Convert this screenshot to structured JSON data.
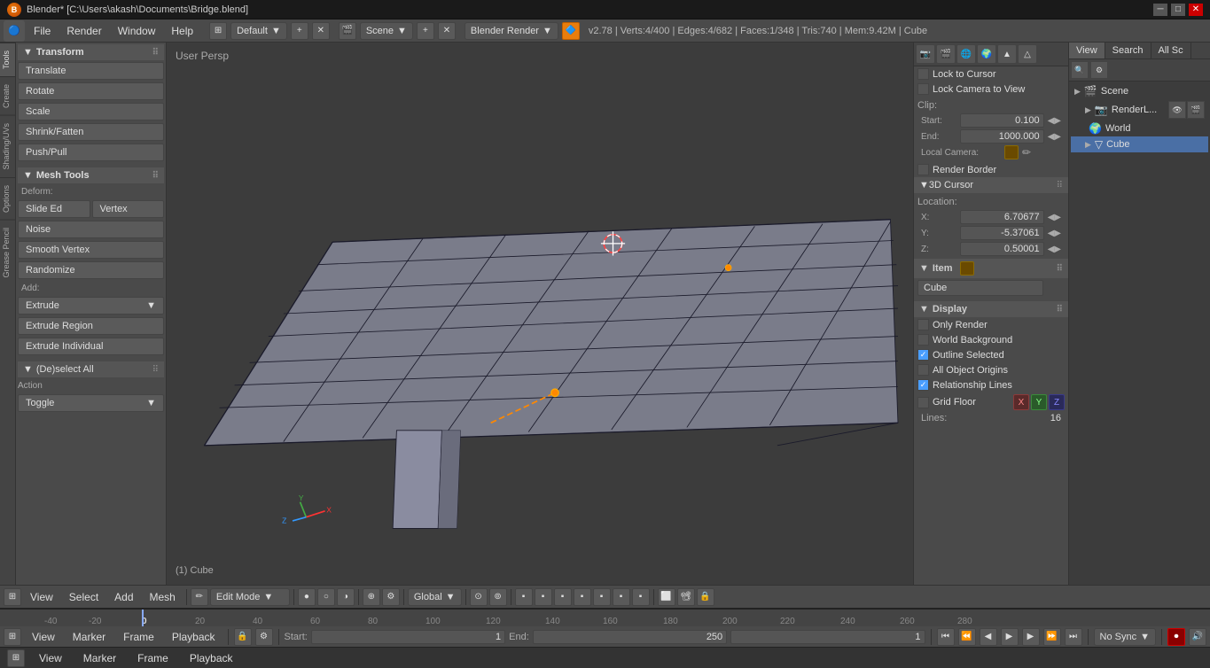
{
  "titlebar": {
    "title": "Blender*  [C:\\Users\\akash\\Documents\\Bridge.blend]",
    "minimize": "─",
    "maximize": "□",
    "close": "✕"
  },
  "menubar": {
    "items": [
      "File",
      "Render",
      "Window",
      "Help"
    ],
    "layout_label": "Default",
    "scene_label": "Scene",
    "render_label": "Blender Render",
    "info": "v2.78 | Verts:4/400 | Edges:4/682 | Faces:1/348 | Tris:740 | Mem:9.42M | Cube"
  },
  "left_panel": {
    "transform_title": "Transform",
    "tools": [
      "Translate",
      "Rotate",
      "Scale",
      "Shrink/Fatten",
      "Push/Pull"
    ],
    "mesh_tools_title": "Mesh Tools",
    "deform_label": "Deform:",
    "deform_tools": [
      "Slide Ed",
      "Vertex"
    ],
    "noise_btn": "Noise",
    "smooth_vertex": "Smooth Vertex",
    "randomize": "Randomize",
    "add_label": "Add:",
    "extrude": "Extrude",
    "extrude_region": "Extrude Region",
    "extrude_individual": "Extrude Individual",
    "deselect_all": "(De)select All",
    "action_label": "Action",
    "toggle_label": "Toggle"
  },
  "viewport": {
    "label": "User Persp",
    "object_label": "(1) Cube"
  },
  "right_panel": {
    "lock_to_cursor": "Lock to Cursor",
    "lock_camera": "Lock Camera to View",
    "clip_label": "Clip:",
    "start_label": "Start:",
    "start_value": "0.100",
    "end_label": "End:",
    "end_value": "1000.000",
    "local_camera": "Local Camera:",
    "render_border": "Render Border",
    "cursor_3d": "3D Cursor",
    "location_label": "Location:",
    "x_label": "X:",
    "x_value": "6.70677",
    "y_label": "Y:",
    "y_value": "-5.37061",
    "z_label": "Z:",
    "z_value": "0.50001",
    "item_title": "Item",
    "item_name": "Cube",
    "display_title": "Display",
    "only_render": "Only Render",
    "world_background": "World Background",
    "outline_selected": "Outline Selected",
    "all_object_origins": "All Object Origins",
    "relationship_lines": "Relationship Lines",
    "grid_floor": "Grid Floor",
    "grid_x": "X",
    "grid_y": "Y",
    "grid_z": "Z",
    "lines_label": "Lines:",
    "lines_value": "16"
  },
  "scene_tree": {
    "tabs": [
      "View",
      "Search",
      "All Sc"
    ],
    "items": [
      {
        "label": "Scene",
        "type": "scene",
        "expanded": true
      },
      {
        "label": "RenderL...",
        "type": "render",
        "expanded": false
      },
      {
        "label": "World",
        "type": "world",
        "expanded": false
      },
      {
        "label": "Cube",
        "type": "cube",
        "selected": true,
        "expanded": true
      }
    ]
  },
  "viewport_toolbar": {
    "mode": "Edit Mode",
    "select_items": [
      "View",
      "Select",
      "Add",
      "Mesh"
    ],
    "pivot": "Global"
  },
  "timeline": {
    "view_label": "View",
    "marker_label": "Marker",
    "frame_label": "Frame",
    "playback_label": "Playback",
    "start_label": "Start:",
    "start_value": "1",
    "end_label": "End:",
    "end_value": "250",
    "current_frame": "1",
    "sync_label": "No Sync",
    "tick_marks": [
      "-40",
      "-20",
      "0",
      "20",
      "40",
      "60",
      "80",
      "100",
      "120",
      "140",
      "160",
      "180",
      "200",
      "220",
      "240",
      "260",
      "280"
    ]
  },
  "status_bar": {
    "items": [
      "View",
      "Marker",
      "Frame",
      "Playback"
    ]
  }
}
